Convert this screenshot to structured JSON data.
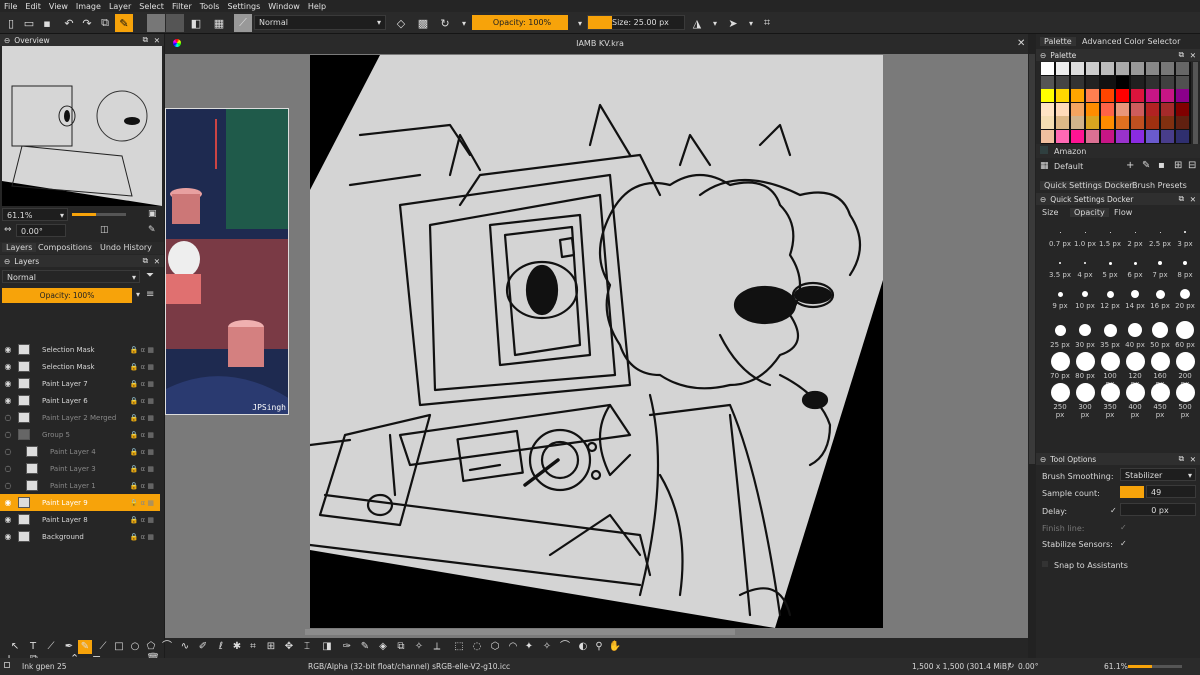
{
  "menu": [
    "File",
    "Edit",
    "View",
    "Image",
    "Layer",
    "Select",
    "Filter",
    "Tools",
    "Settings",
    "Window",
    "Help"
  ],
  "toolbar": {
    "blend_mode": "Normal",
    "opacity_label": "Opacity: 100%",
    "size_label": "Size: 25.00 px"
  },
  "document": {
    "title": "IAMB KV.kra"
  },
  "overview": {
    "title": "Overview",
    "zoom": "61.1%",
    "rotation": "0.00°"
  },
  "layers_panel": {
    "tabs": [
      "Layers",
      "Compositions",
      "Undo History"
    ],
    "title": "Layers",
    "blend_mode": "Normal",
    "opacity_label": "Opacity:  100%",
    "layers": [
      {
        "name": "Selection Mask",
        "style": "normal"
      },
      {
        "name": "Selection Mask",
        "style": "normal"
      },
      {
        "name": "Paint Layer 7",
        "style": "normal"
      },
      {
        "name": "Paint Layer 6",
        "style": "normal"
      },
      {
        "name": "Paint Layer 2 Merged",
        "style": "dim"
      },
      {
        "name": "Group 5",
        "style": "dim"
      },
      {
        "name": "Paint Layer 4",
        "style": "dim"
      },
      {
        "name": "Paint Layer 3",
        "style": "dim"
      },
      {
        "name": "Paint Layer 1",
        "style": "dim"
      },
      {
        "name": "Paint Layer 9",
        "style": "selected"
      },
      {
        "name": "Paint Layer 8",
        "style": "normal"
      },
      {
        "name": "Background",
        "style": "normal"
      }
    ]
  },
  "reference_image": {
    "signature": "JPSingh"
  },
  "right_panel": {
    "top_tabs": [
      "Palette",
      "Advanced Color Selector"
    ],
    "palette_title": "Palette",
    "palette_name": "Amazon",
    "palette_preset": "Default",
    "qs_tabs": [
      "Quick Settings Docker",
      "Brush Presets"
    ],
    "qs_title": "Quick Settings Docker",
    "qs_subtabs": [
      "Size",
      "Opacity",
      "Flow"
    ],
    "brush_sizes": [
      [
        "0.7 px",
        "1.0 px",
        "1.5 px",
        "2 px",
        "2.5 px",
        "3 px"
      ],
      [
        "3.5 px",
        "4 px",
        "5 px",
        "6 px",
        "7 px",
        "8 px"
      ],
      [
        "9 px",
        "10 px",
        "12 px",
        "14 px",
        "16 px",
        "20 px"
      ],
      [
        "25 px",
        "30 px",
        "35 px",
        "40 px",
        "50 px",
        "60 px"
      ],
      [
        "70 px",
        "80 px",
        "100 px",
        "120 px",
        "160 px",
        "200 px"
      ],
      [
        "250 px",
        "300 px",
        "350 px",
        "400 px",
        "450 px",
        "500 px"
      ]
    ],
    "tool_options_title": "Tool Options",
    "brush_smoothing_label": "Brush Smoothing:",
    "brush_smoothing_value": "Stabilizer",
    "sample_count_label": "Sample count:",
    "sample_count_value": "49",
    "delay_label": "Delay:",
    "delay_value": "0 px",
    "finish_line_label": "Finish line:",
    "stabilize_label": "Stabilize Sensors:",
    "snap_label": "Snap to Assistants"
  },
  "status": {
    "brush": "Ink gpen 25",
    "color_space": "RGB/Alpha (32-bit float/channel)  sRGB-elle-V2-g10.icc",
    "dimensions": "1,500 x 1,500 (301.4 MiB)",
    "rotation": "0.00°",
    "zoom": "61.1%"
  },
  "colors": {
    "accent": "#f7a30a",
    "palette_row1": [
      "#ffffff",
      "#eeeeee",
      "#dddddd",
      "#cccccc",
      "#bbbbbb",
      "#aaaaaa",
      "#999999",
      "#888888",
      "#777777",
      "#666666"
    ],
    "palette_row2": [
      "#555555",
      "#444444",
      "#333333",
      "#222222",
      "#111111",
      "#000000",
      "#202020",
      "#303030",
      "#404040",
      "#505050"
    ],
    "palette_row3": [
      "#ffff00",
      "#ffd700",
      "#ffa500",
      "#ff7f50",
      "#ff4500",
      "#ff0000",
      "#dc143c",
      "#c71585",
      "#c71585",
      "#8b008b"
    ],
    "palette_row4": [
      "#ffe4c4",
      "#ffdab9",
      "#f4a460",
      "#ff8c00",
      "#ff6347",
      "#e9967a",
      "#cd5c5c",
      "#b22222",
      "#a52a2a",
      "#800000"
    ],
    "palette_row5": [
      "#f5deb3",
      "#deb887",
      "#d2b48c",
      "#daa520",
      "#ff8c00",
      "#e07020",
      "#c05020",
      "#a03010",
      "#803010",
      "#602010"
    ],
    "palette_row6": [
      "#f0c0a0",
      "#ff69b4",
      "#ff1493",
      "#db7093",
      "#c71585",
      "#9932cc",
      "#8a2be2",
      "#6a5acd",
      "#483d8b",
      "#2f2f6f"
    ]
  }
}
